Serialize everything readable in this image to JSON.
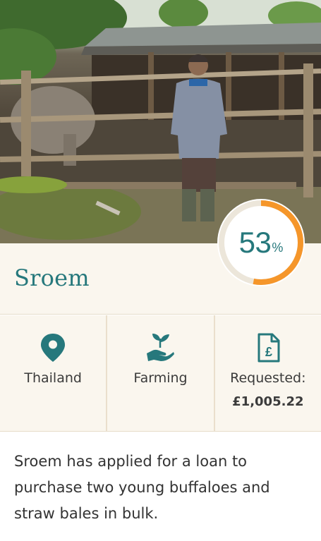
{
  "loan": {
    "borrower_name": "Sroem",
    "progress_percent": 53,
    "progress_number": "53",
    "progress_symbol": "%",
    "country": "Thailand",
    "sector": "Farming",
    "requested_label": "Requested:",
    "requested_amount": "£1,005.22",
    "description": "Sroem has applied for a loan to purchase two young buffaloes and straw bales in bulk."
  },
  "colors": {
    "accent_teal": "#26787c",
    "progress_orange": "#f5962a",
    "ring_track": "#ece6da",
    "panel_bg": "#faf6ee"
  },
  "icons": {
    "country": "location-pin-icon",
    "sector": "hand-with-sprout-icon",
    "requested": "pound-document-icon"
  }
}
